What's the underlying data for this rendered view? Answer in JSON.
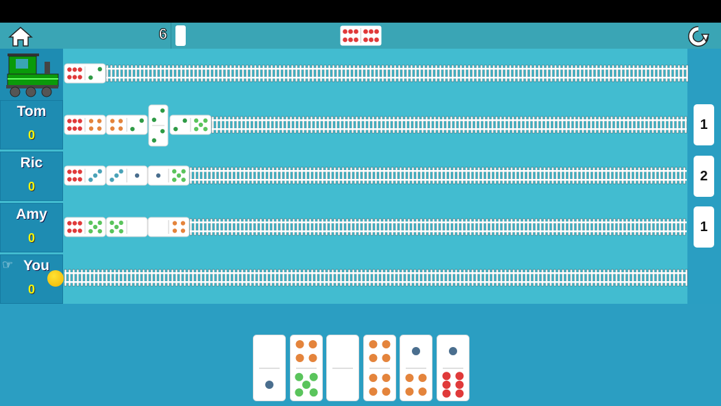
{
  "header": {
    "home_icon": "home-icon",
    "boneyard_count": "6",
    "engine_double": [
      6,
      6
    ],
    "restart_icon": "restart-icon"
  },
  "colors": {
    "pip": {
      "1": "#4a6e8e",
      "2": "#2e9a45",
      "3": "#4aa3b8",
      "4": "#e4843c",
      "5": "#5ac45c",
      "6": "#e03a3a"
    },
    "board": "#42bcd0",
    "panel": "#1e8cb2",
    "score": "#f4f40c"
  },
  "mexican_train": {
    "icon": "train-icon",
    "tiles": [
      [
        6,
        2
      ]
    ]
  },
  "players": [
    {
      "name": "Tom",
      "score": "0",
      "hand_count": "1",
      "tiles": [
        [
          6,
          4
        ],
        [
          4,
          2
        ],
        {
          "double": 2
        },
        [
          2,
          5
        ]
      ]
    },
    {
      "name": "Ric",
      "score": "0",
      "hand_count": "2",
      "tiles": [
        [
          6,
          3
        ],
        [
          3,
          1
        ],
        [
          1,
          5
        ]
      ]
    },
    {
      "name": "Amy",
      "score": "0",
      "hand_count": "1",
      "tiles": [
        [
          6,
          5
        ],
        [
          5,
          0
        ],
        [
          0,
          4
        ]
      ]
    },
    {
      "name": "You",
      "score": "0",
      "hand_count": null,
      "tiles": [],
      "current": true
    }
  ],
  "hand": [
    [
      0,
      1
    ],
    [
      4,
      5
    ],
    [
      0,
      0
    ],
    [
      4,
      4
    ],
    [
      1,
      4
    ],
    [
      1,
      6
    ]
  ]
}
